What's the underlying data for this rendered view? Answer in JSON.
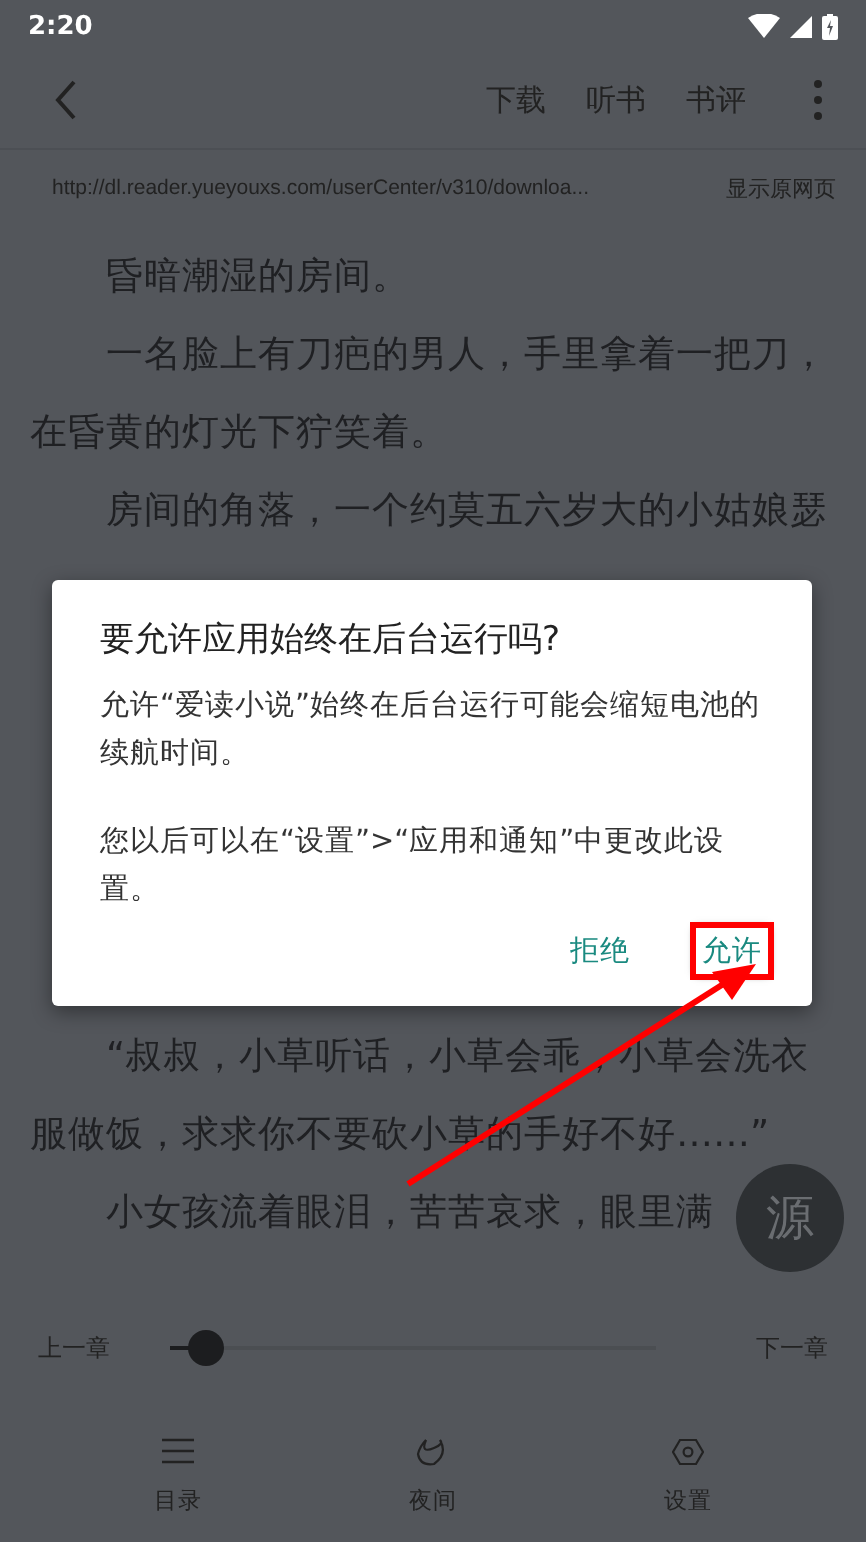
{
  "status_bar": {
    "time": "2:20"
  },
  "toolbar": {
    "actions": [
      "下载",
      "听书",
      "书评"
    ]
  },
  "url_bar": {
    "url": "http://dl.reader.yueyouxs.com/userCenter/v310/downloa...",
    "action": "显示原网页"
  },
  "book_lines": [
    {
      "kind": "text",
      "text": "　　昏暗潮湿的房间。"
    },
    {
      "kind": "text",
      "text": "　　一名脸上有刀疤的男人，手里拿着一把刀，"
    },
    {
      "kind": "text",
      "text": "在昏黄的灯光下狞笑着。"
    },
    {
      "kind": "text",
      "text": "　　房间的角落，一个约莫五六岁大的小姑娘瑟"
    },
    {
      "kind": "covered"
    },
    {
      "kind": "covered"
    },
    {
      "kind": "covered"
    },
    {
      "kind": "covered"
    },
    {
      "kind": "covered"
    },
    {
      "kind": "covered"
    },
    {
      "kind": "text",
      "text": "　　“叔叔，小草听话，小草会乖，小草会洗衣"
    },
    {
      "kind": "text",
      "text": "服做饭，求求你不要砍小草的手好不好……”"
    },
    {
      "kind": "text",
      "text": "　　小女孩流着眼泪，苦苦哀求，眼里满"
    }
  ],
  "source_button": "源",
  "chapter_bar": {
    "prev": "上一章",
    "next": "下一章",
    "level": 0.04
  },
  "bottom_nav": [
    {
      "kind": "menu",
      "label": "目录"
    },
    {
      "kind": "moon",
      "label": "夜间"
    },
    {
      "kind": "gear",
      "label": "设置"
    }
  ],
  "dialog": {
    "title": "要允许应用始终在后台运行吗?",
    "paragraphs": [
      "允许“爱读小说”始终在后台运行可能会缩短电池的续航时间。",
      "您以后可以在“设置”>“应用和通知”中更改此设置。"
    ],
    "buttons": [
      {
        "label": "拒绝",
        "highlighted": false
      },
      {
        "label": "允许",
        "highlighted": true
      }
    ]
  }
}
